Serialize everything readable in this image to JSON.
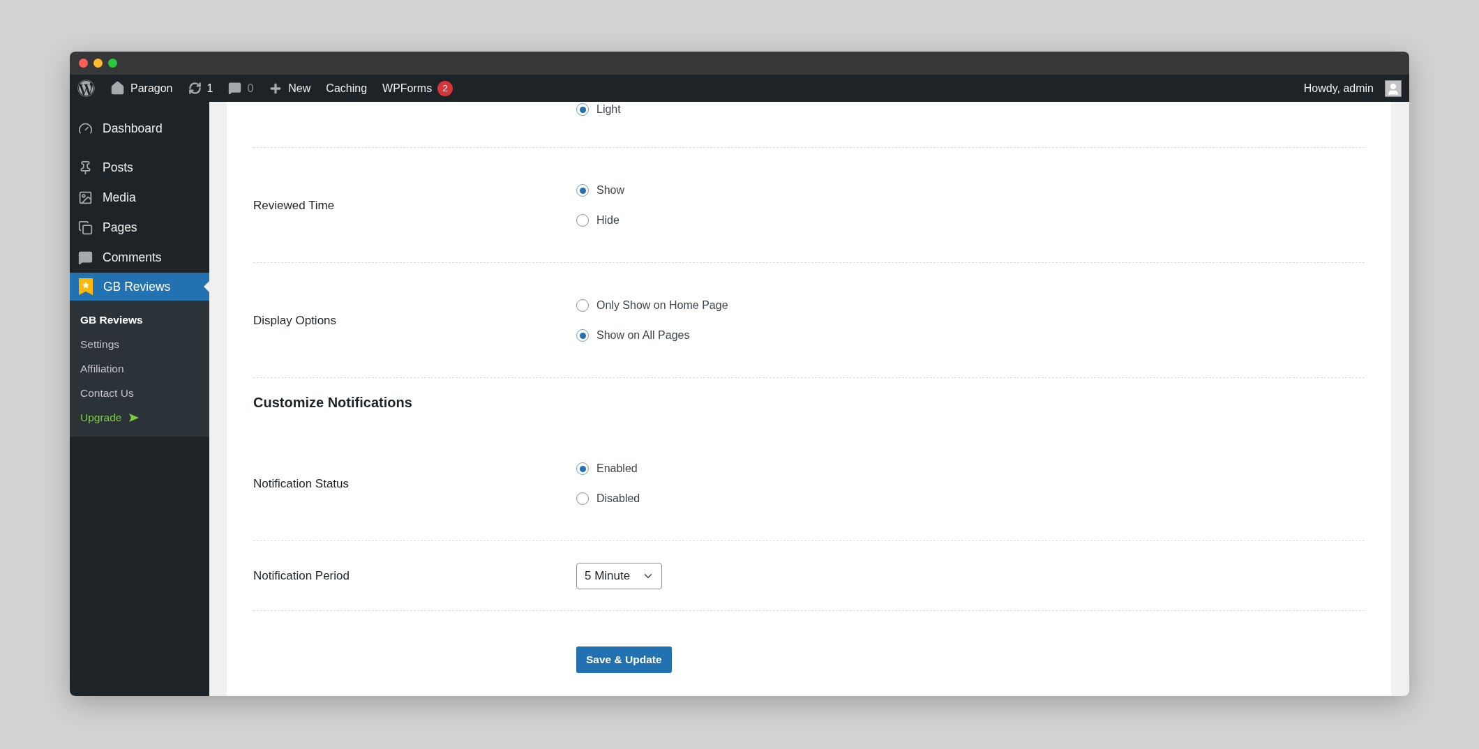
{
  "admin_bar": {
    "site": "Paragon",
    "updates": "1",
    "comments": "0",
    "new": "New",
    "links": [
      {
        "label": "Caching"
      },
      {
        "label": "WPForms",
        "badge": "2"
      }
    ],
    "greeting": "Howdy, admin"
  },
  "sidebar": {
    "items": [
      {
        "label": "Dashboard",
        "selected": false
      },
      {
        "label": "Posts",
        "selected": false
      },
      {
        "label": "Media",
        "selected": false
      },
      {
        "label": "Pages",
        "selected": false
      },
      {
        "label": "Comments",
        "selected": false
      },
      {
        "label": "GB Reviews",
        "selected": true
      }
    ],
    "submenu": [
      {
        "label": "GB Reviews",
        "selected": true,
        "kind": "link"
      },
      {
        "label": "Settings",
        "selected": false,
        "kind": "link"
      },
      {
        "label": "Affiliation",
        "selected": false,
        "kind": "link"
      },
      {
        "label": "Contact Us",
        "selected": false,
        "kind": "link"
      },
      {
        "label": "Upgrade",
        "selected": false,
        "kind": "upgrade"
      }
    ]
  },
  "settings": [
    {
      "kind": "radio",
      "options": [
        {
          "label": "Light",
          "selected": true
        }
      ]
    },
    {
      "kind": "radio",
      "label": "Reviewed Time",
      "options": [
        {
          "label": "Show",
          "selected": true
        },
        {
          "label": "Hide",
          "selected": false
        }
      ]
    },
    {
      "kind": "radio",
      "label": "Display Options",
      "options": [
        {
          "label": "Only Show on Home Page",
          "selected": false
        },
        {
          "label": "Show on All Pages",
          "selected": true
        }
      ]
    },
    {
      "kind": "heading",
      "title": "Customize Notifications"
    },
    {
      "kind": "radio",
      "label": "Notification Status",
      "options": [
        {
          "label": "Enabled",
          "selected": true
        },
        {
          "label": "Disabled",
          "selected": false
        }
      ]
    },
    {
      "kind": "select",
      "label": "Notification Period",
      "value": "5 Minute"
    }
  ],
  "save_button": "Save & Update"
}
